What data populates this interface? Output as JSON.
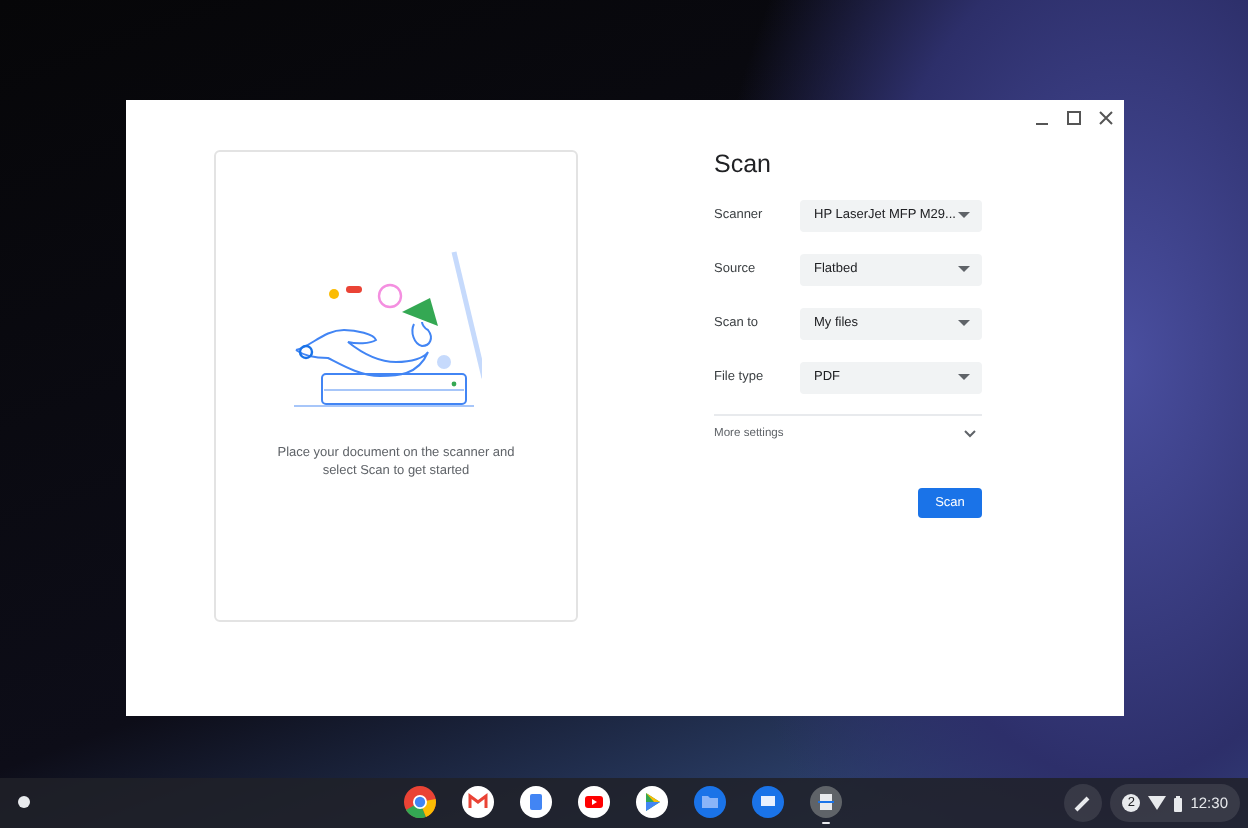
{
  "window": {
    "title": "Scan"
  },
  "illustration": {
    "caption": "Place your document on the scanner and select Scan to get started"
  },
  "settings": [
    {
      "label": "Scanner",
      "value": "HP LaserJet MFP M29..."
    },
    {
      "label": "Source",
      "value": "Flatbed"
    },
    {
      "label": "Scan to",
      "value": "My files"
    },
    {
      "label": "File type",
      "value": "PDF"
    }
  ],
  "more_settings": {
    "label": "More settings",
    "expanded": false
  },
  "scan_button": "Scan",
  "shelf": {
    "apps": [
      {
        "kind": "chrome",
        "running": false
      },
      {
        "kind": "mail",
        "running": false
      },
      {
        "kind": "docs",
        "running": false
      },
      {
        "kind": "video",
        "running": false
      },
      {
        "kind": "play",
        "running": false
      },
      {
        "kind": "files",
        "running": false
      },
      {
        "kind": "messages",
        "running": false
      },
      {
        "kind": "scan",
        "running": true
      }
    ],
    "notification_count": "2",
    "time": "12:30"
  }
}
